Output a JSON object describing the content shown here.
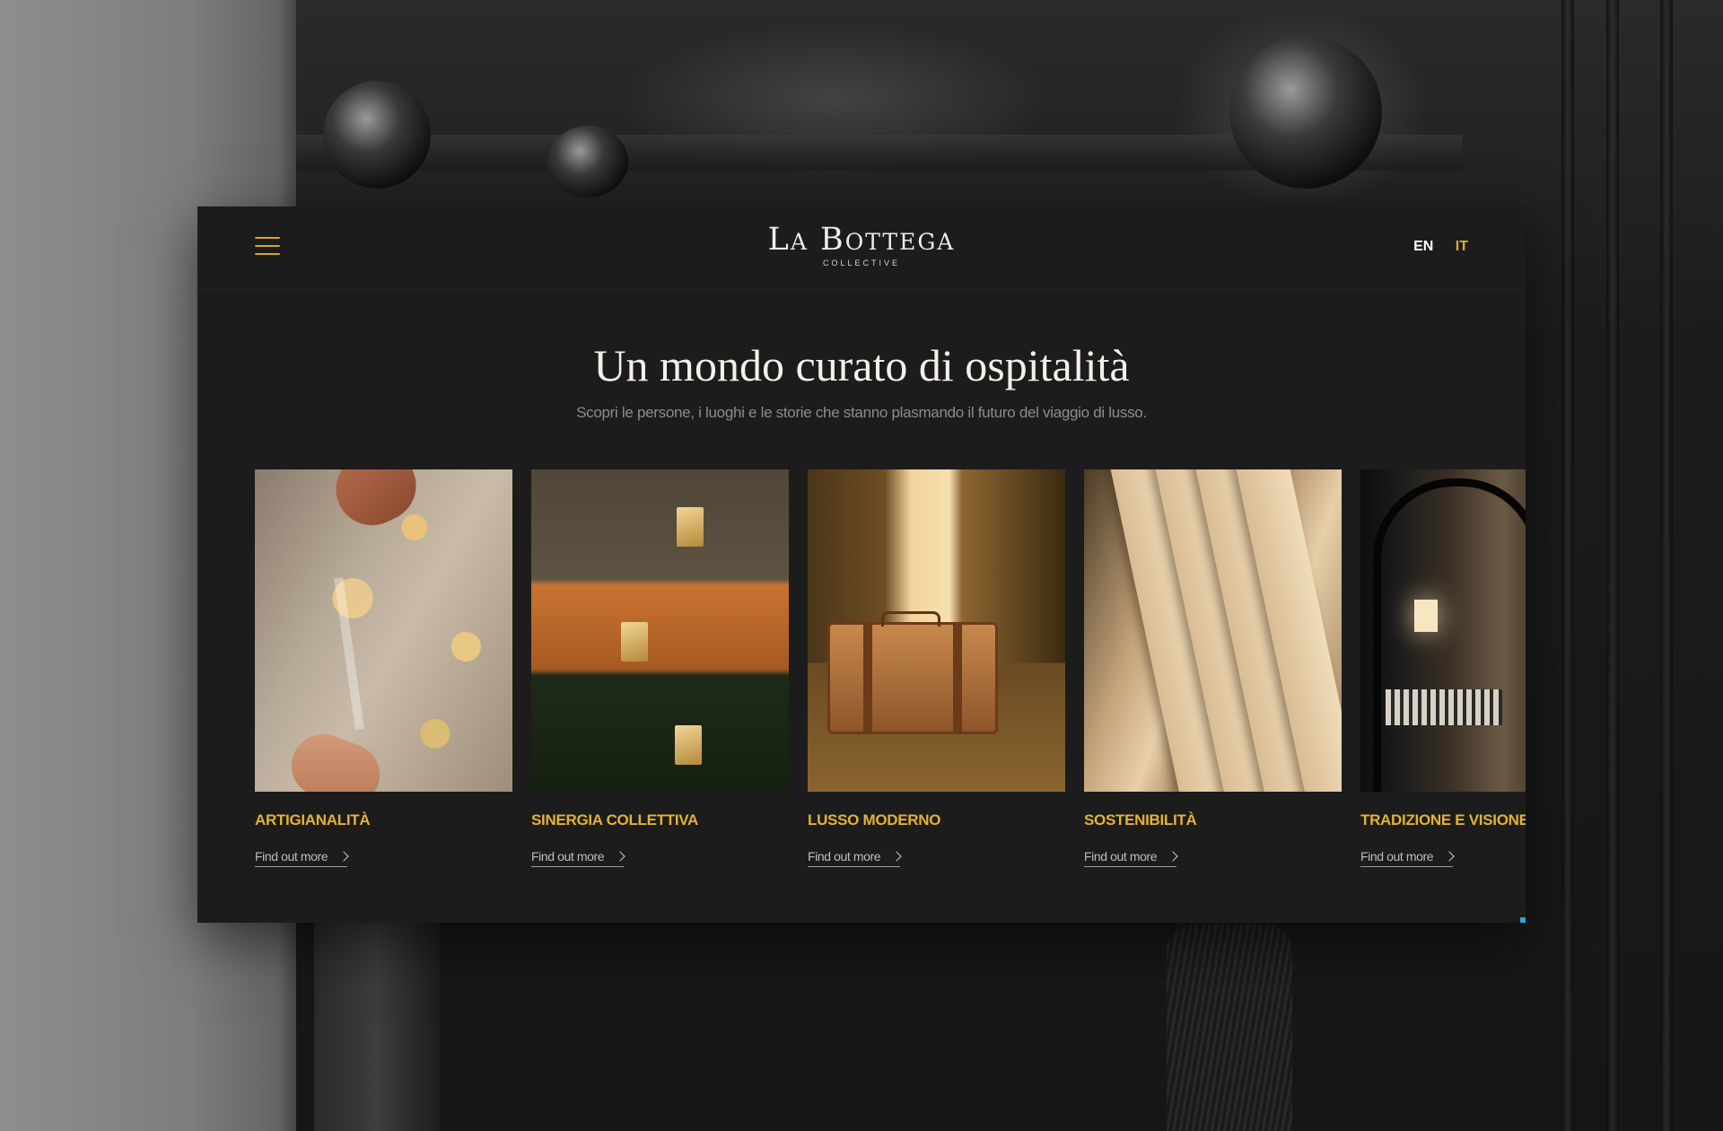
{
  "header": {
    "menu_icon": "hamburger-menu-icon",
    "logo_main": "La Bottega",
    "logo_sub": "COLLECTIVE",
    "languages": [
      {
        "code": "EN",
        "active": true
      },
      {
        "code": "IT",
        "active": false
      }
    ]
  },
  "hero": {
    "title": "Un mondo curato di ospitalità",
    "subtitle": "Scopri le persone, i luoghi e le storie che stanno plasmando il futuro del viaggio di lusso."
  },
  "cards": [
    {
      "title": "ARTIGIANALITÀ",
      "link": "Find out more"
    },
    {
      "title": "SINERGIA COLLETTIVA",
      "link": "Find out more"
    },
    {
      "title": "LUSSO MODERNO",
      "link": "Find out more"
    },
    {
      "title": "SOSTENIBILITÀ",
      "link": "Find out more"
    },
    {
      "title": "TRADIZIONE E VISIONE",
      "link": "Find out more"
    }
  ],
  "colors": {
    "accent": "#e0ad2c",
    "card_background": "#1c1c1c",
    "text_primary": "#f4f0e8",
    "text_muted": "#8c8c8c"
  }
}
